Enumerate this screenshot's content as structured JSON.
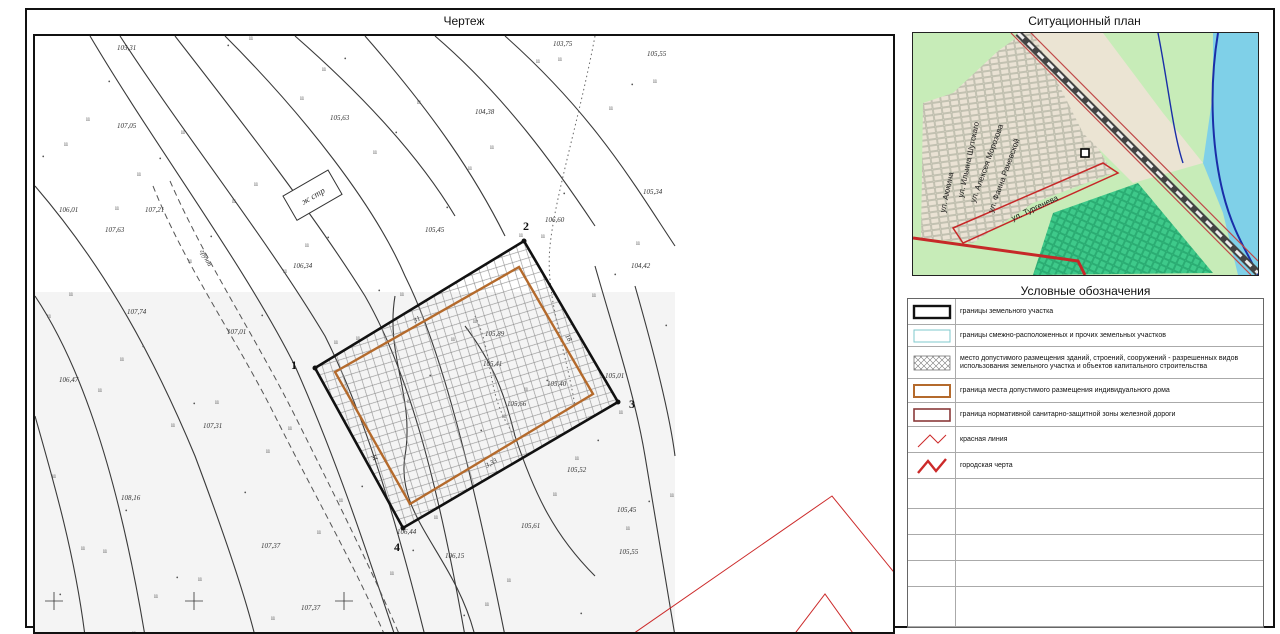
{
  "headers": {
    "drawing": "Чертеж",
    "situation_plan": "Ситуационный план",
    "legend": "Условные обозначения"
  },
  "parcel": {
    "corners": [
      "1",
      "2",
      "3",
      "4"
    ]
  },
  "survey_labels": [
    "105,31",
    "103,75",
    "105,55",
    "107,05",
    "105,63",
    "104,38",
    "105,34",
    "106,01",
    "107,21",
    "106,60",
    "107,63",
    "105,45",
    "104,42",
    "106,34",
    "107,74",
    "107,01",
    "105,01",
    "106,47",
    "107,31",
    "105,52",
    "108,16",
    "105,45",
    "105,61",
    "107,37",
    "106,44",
    "106,15",
    "105,55",
    "107,37",
    "105,89",
    "105,41",
    "105,40",
    "105,66"
  ],
  "map_text": {
    "building_mark": "ж стр",
    "road_label": "грунт",
    "dim_top": "31",
    "dim_right": "18",
    "dim_bottom": "3,33",
    "dim_left": "М"
  },
  "streets": [
    "ул. Аюкина",
    "ул. Ильина Шутскаго",
    "ул. Алексея Морозова",
    "ул. Фаина Раневской",
    "ул. Тургенева"
  ],
  "legend_items": [
    {
      "symbol": "parcel-boundary",
      "text": "границы земельного участка"
    },
    {
      "symbol": "adjacent-parcels",
      "text": "границы смежно-расположенных  и прочих земельных участков"
    },
    {
      "symbol": "hatched-area",
      "text": "место допустимого размещения зданий, строений, сооружений - разрешенных видов использования земельного участка и объектов капитального строительства"
    },
    {
      "symbol": "house-boundary",
      "text": "граница места допустимого размещения индивидуального дома"
    },
    {
      "symbol": "sanitary-zone",
      "text": "граница нормативной санитарно-защитной зоны железной дороги"
    },
    {
      "symbol": "red-line",
      "text": "красная линия"
    },
    {
      "symbol": "city-line",
      "text": "городская черта"
    },
    {
      "symbol": "empty",
      "text": ""
    },
    {
      "symbol": "empty",
      "text": ""
    },
    {
      "symbol": "empty",
      "text": ""
    },
    {
      "symbol": "empty",
      "text": ""
    },
    {
      "symbol": "empty",
      "text": ""
    }
  ],
  "colors": {
    "parcel_boundary": "#111111",
    "house_boundary": "#b46a2c",
    "sanitary_zone": "#8a3a3a",
    "red_line": "#cc2a2a",
    "adjacent_parcels": "#7fc8cc",
    "situation_green": "#c7ecb8",
    "situation_dense": "#3ec98a",
    "water": "#7fd0e8",
    "railway": "#444444"
  }
}
